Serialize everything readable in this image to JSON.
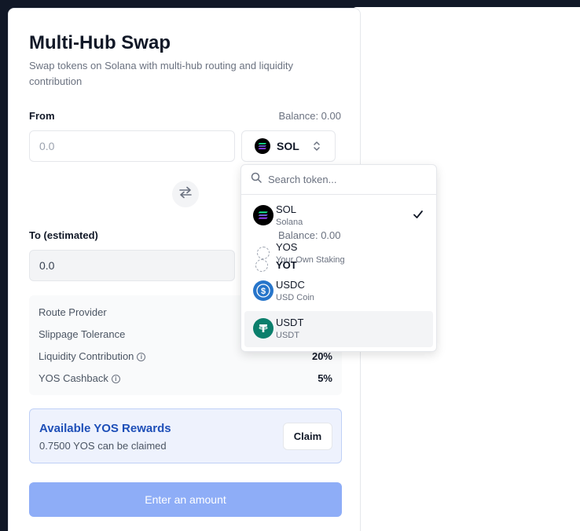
{
  "app": {
    "title": "Multi-Hub Swap",
    "subtitle": "Swap tokens on Solana with multi-hub routing and liquidity contribution"
  },
  "from": {
    "label": "From",
    "balance": "Balance: 0.00",
    "amount_placeholder": "0.0",
    "token": "SOL"
  },
  "to": {
    "label": "To (estimated)",
    "balance": "Balance: 0.00",
    "amount": "0.0",
    "token": "YOT"
  },
  "details": {
    "rows": [
      {
        "label": "Route Provider",
        "value": ""
      },
      {
        "label": "Slippage Tolerance",
        "value": ""
      },
      {
        "label": "Liquidity Contribution",
        "value": "20%"
      },
      {
        "label": "YOS Cashback",
        "value": "5%"
      }
    ]
  },
  "rewards": {
    "title": "Available YOS Rewards",
    "subtitle": "0.7500 YOS can be claimed",
    "claim_label": "Claim"
  },
  "cta_label": "Enter an amount",
  "dropdown": {
    "search_placeholder": "Search token...",
    "options": [
      {
        "symbol": "SOL",
        "name": "Solana",
        "selected": true,
        "icon": "solana-logo-icon"
      },
      {
        "symbol": "YOS",
        "name": "Your Own Staking",
        "selected": false,
        "icon": "yos-dashed-circle-icon"
      },
      {
        "symbol": "USDC",
        "name": "USD Coin",
        "selected": false,
        "icon": "usdc-logo-icon"
      },
      {
        "symbol": "USDT",
        "name": "USDT",
        "selected": false,
        "icon": "usdt-logo-icon"
      }
    ]
  },
  "colors": {
    "accent": "#1e4fb8",
    "cta_disabled": "#8eadf7",
    "usdc": "#2775ca",
    "usdt": "#0b7f6c",
    "dark_bg": "#111827"
  }
}
